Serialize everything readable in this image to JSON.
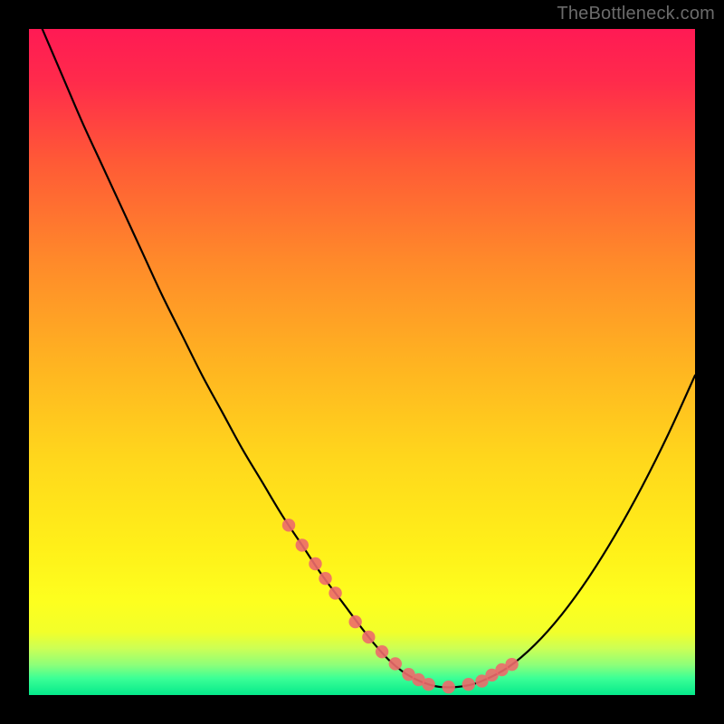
{
  "watermark": "TheBottleneck.com",
  "colors": {
    "frame": "#000000",
    "curve": "#000000",
    "marker_fill": "#ed6a6c",
    "marker_stroke": "#ed6a6c",
    "gradient_stops": [
      {
        "offset": 0.0,
        "color": "#ff1a54"
      },
      {
        "offset": 0.08,
        "color": "#ff2b4b"
      },
      {
        "offset": 0.2,
        "color": "#ff5a36"
      },
      {
        "offset": 0.35,
        "color": "#ff8a2a"
      },
      {
        "offset": 0.5,
        "color": "#ffb321"
      },
      {
        "offset": 0.65,
        "color": "#ffd81c"
      },
      {
        "offset": 0.78,
        "color": "#fff019"
      },
      {
        "offset": 0.86,
        "color": "#fdff1f"
      },
      {
        "offset": 0.905,
        "color": "#f2ff2a"
      },
      {
        "offset": 0.93,
        "color": "#ccff55"
      },
      {
        "offset": 0.955,
        "color": "#8cff7a"
      },
      {
        "offset": 0.975,
        "color": "#3bff96"
      },
      {
        "offset": 1.0,
        "color": "#05e98b"
      }
    ]
  },
  "chart_data": {
    "type": "line",
    "title": "",
    "xlabel": "",
    "ylabel": "",
    "xlim": [
      0,
      100
    ],
    "ylim": [
      0,
      100
    ],
    "grid": false,
    "series": [
      {
        "name": "bottleneck-curve",
        "x": [
          2,
          5,
          8,
          11,
          14,
          17,
          20,
          23,
          26,
          29,
          32,
          35,
          38,
          41,
          44,
          47,
          50,
          52,
          54,
          56,
          58,
          60,
          62,
          65,
          68,
          72,
          76,
          80,
          84,
          88,
          92,
          96,
          100
        ],
        "y": [
          100,
          93,
          86,
          79.5,
          73,
          66.5,
          60,
          54,
          48,
          42.5,
          37,
          32,
          27,
          22.5,
          18,
          14,
          10,
          7.5,
          5.3,
          3.6,
          2.4,
          1.6,
          1.2,
          1.3,
          2.1,
          4.2,
          7.6,
          12.1,
          17.6,
          24.0,
          31.2,
          39.2,
          48.0
        ]
      }
    ],
    "markers": {
      "name": "highlighted-points",
      "x": [
        39,
        41,
        43,
        44.5,
        46,
        49,
        51,
        53,
        55,
        57,
        58.5,
        60,
        63,
        66,
        68,
        69.5,
        71,
        72.5
      ],
      "y": [
        25.5,
        22.5,
        19.7,
        17.5,
        15.3,
        11.0,
        8.7,
        6.5,
        4.7,
        3.1,
        2.3,
        1.6,
        1.2,
        1.6,
        2.1,
        3.0,
        3.8,
        4.6
      ]
    }
  }
}
